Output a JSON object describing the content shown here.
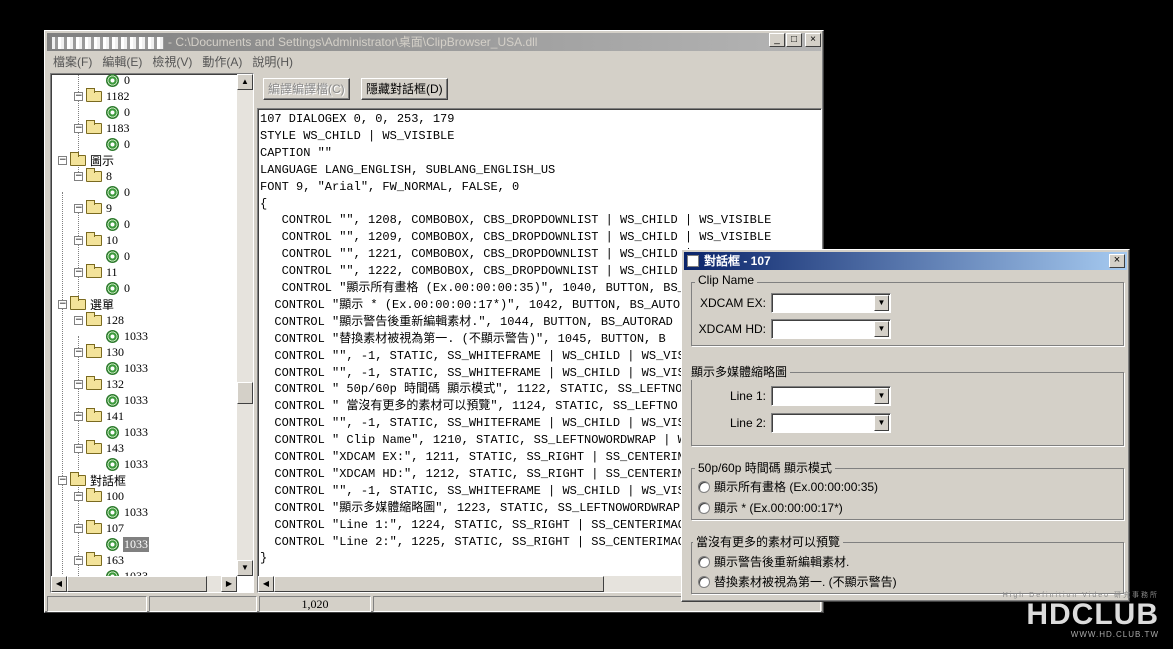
{
  "window": {
    "title": "- C:\\Documents and Settings\\Administrator\\桌面\\ClipBrowser_USA.dll",
    "controls": {
      "minimize": "_",
      "maximize": "□",
      "close": "×"
    }
  },
  "menu": [
    "檔案(F)",
    "編輯(E)",
    "檢視(V)",
    "動作(A)",
    "說明(H)"
  ],
  "toolbar": {
    "compile_label": "編譯編譯檔(C)",
    "hide_dialog_label": "隱藏對話框(D)"
  },
  "tree": {
    "nodes": [
      {
        "label": "0"
      },
      {
        "label": "1182"
      },
      {
        "label": "0"
      },
      {
        "label": "1183"
      },
      {
        "label": "0"
      },
      {
        "label": "圖示"
      },
      {
        "label": "8"
      },
      {
        "label": "0"
      },
      {
        "label": "9"
      },
      {
        "label": "0"
      },
      {
        "label": "10"
      },
      {
        "label": "0"
      },
      {
        "label": "11"
      },
      {
        "label": "0"
      },
      {
        "label": "選單"
      },
      {
        "label": "128"
      },
      {
        "label": "1033"
      },
      {
        "label": "130"
      },
      {
        "label": "1033"
      },
      {
        "label": "132"
      },
      {
        "label": "1033"
      },
      {
        "label": "141"
      },
      {
        "label": "1033"
      },
      {
        "label": "143"
      },
      {
        "label": "1033"
      },
      {
        "label": "對話框"
      },
      {
        "label": "100"
      },
      {
        "label": "1033"
      },
      {
        "label": "107"
      },
      {
        "label": "1033"
      },
      {
        "label": "163"
      },
      {
        "label": "1033"
      }
    ]
  },
  "code_lines": [
    "107 DIALOGEX 0, 0, 253, 179",
    "STYLE WS_CHILD | WS_VISIBLE",
    "CAPTION \"\"",
    "LANGUAGE LANG_ENGLISH, SUBLANG_ENGLISH_US",
    "FONT 9, \"Arial\", FW_NORMAL, FALSE, 0",
    "{",
    "   CONTROL \"\", 1208, COMBOBOX, CBS_DROPDOWNLIST | WS_CHILD | WS_VISIBLE",
    "   CONTROL \"\", 1209, COMBOBOX, CBS_DROPDOWNLIST | WS_CHILD | WS_VISIBLE",
    "   CONTROL \"\", 1221, COMBOBOX, CBS_DROPDOWNLIST | WS_CHILD | WS_VISIBLE",
    "   CONTROL \"\", 1222, COMBOBOX, CBS_DROPDOWNLIST | WS_CHILD | WS_VISIBLE",
    "   CONTROL \"顯示所有畫格 (Ex.00:00:00:35)\", 1040, BUTTON, BS_",
    "  CONTROL \"顯示 * (Ex.00:00:00:17*)\", 1042, BUTTON, BS_AUTOR",
    "  CONTROL \"顯示警告後重新編輯素材.\", 1044, BUTTON, BS_AUTORAD",
    "  CONTROL \"替換素材被視為第一. (不顯示警告)\", 1045, BUTTON, B",
    "  CONTROL \"\", -1, STATIC, SS_WHITEFRAME | WS_CHILD | WS_VISI",
    "  CONTROL \"\", -1, STATIC, SS_WHITEFRAME | WS_CHILD | WS_VISI",
    "  CONTROL \" 50p/60p 時間碼 顯示模式\", 1122, STATIC, SS_LEFTNO",
    "  CONTROL \" 當沒有更多的素材可以預覽\", 1124, STATIC, SS_LEFTNO",
    "  CONTROL \"\", -1, STATIC, SS_WHITEFRAME | WS_CHILD | WS_VISI",
    "  CONTROL \" Clip Name\", 1210, STATIC, SS_LEFTNOWORDWRAP | WS",
    "  CONTROL \"XDCAM EX:\", 1211, STATIC, SS_RIGHT | SS_CENTERIMA",
    "  CONTROL \"XDCAM HD:\", 1212, STATIC, SS_RIGHT | SS_CENTERIMA",
    "  CONTROL \"\", -1, STATIC, SS_WHITEFRAME | WS_CHILD | WS_VISI",
    "  CONTROL \"顯示多媒體縮略圖\", 1223, STATIC, SS_LEFTNOWORDWRAP",
    "  CONTROL \"Line 1:\", 1224, STATIC, SS_RIGHT | SS_CENTERIMAGE",
    "  CONTROL \"Line 2:\", 1225, STATIC, SS_RIGHT | SS_CENTERIMAGE",
    "}"
  ],
  "status": {
    "position": "1,020"
  },
  "dialog": {
    "title": "對話框 - 107",
    "close": "×",
    "clip_name_group": "Clip Name",
    "xdcam_ex_label": "XDCAM EX:",
    "xdcam_hd_label": "XDCAM HD:",
    "thumb_group": "顯示多媒體縮略圖",
    "line1_label": "Line 1:",
    "line2_label": "Line 2:",
    "tc_group": "50p/60p 時間碼 顯示模式",
    "tc_option1": "顯示所有畫格 (Ex.00:00:00:35)",
    "tc_option2": "顯示 * (Ex.00:00:00:17*)",
    "preview_group": "當沒有更多的素材可以預覽",
    "preview_option1": "顯示警告後重新編輯素材.",
    "preview_option2": "替換素材被視為第一. (不顯示警告)"
  },
  "watermark": {
    "top": "High Definition Video 研究事務所",
    "logo": "HDCLUB",
    "url": "WWW.HD.CLUB.TW"
  }
}
